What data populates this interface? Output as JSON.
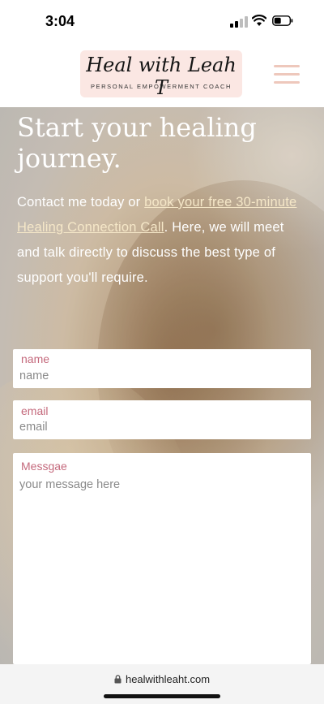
{
  "status_bar": {
    "time": "3:04"
  },
  "header": {
    "logo_script": "Heal with Leah T",
    "logo_subtitle": "PERSONAL EMPOWERMENT COACH",
    "colors": {
      "logo_bg": "#fbe7e3",
      "menu_icon": "#eec8bc"
    }
  },
  "hero": {
    "title": "Start your healing\njourney.",
    "text_before": "Contact me today or ",
    "link_text": "book your free 30-minute Healing Connection Call",
    "text_after": ". Here, we will meet and talk directly to discuss the best type of support you'll require."
  },
  "form": {
    "name": {
      "label": "name",
      "placeholder": "name"
    },
    "email": {
      "label": "email",
      "placeholder": "email"
    },
    "message": {
      "label": "Messgae",
      "placeholder": "your message here"
    },
    "label_color": "#c4697c"
  },
  "browser": {
    "url": "healwithleaht.com"
  }
}
